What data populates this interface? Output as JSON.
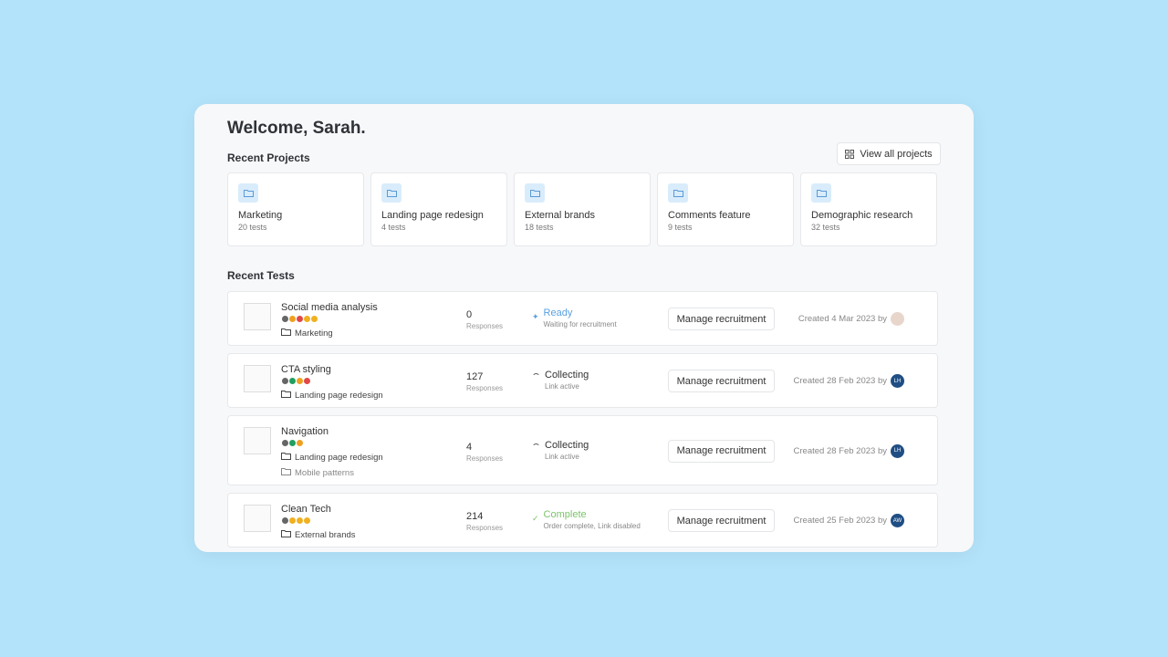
{
  "welcome": "Welcome, Sarah.",
  "recent_projects": {
    "title": "Recent Projects",
    "view_all": "View all projects",
    "items": [
      {
        "name": "Marketing",
        "count": "20 tests"
      },
      {
        "name": "Landing page redesign",
        "count": "4 tests"
      },
      {
        "name": "External brands",
        "count": "18 tests"
      },
      {
        "name": "Comments feature",
        "count": "9 tests"
      },
      {
        "name": "Demographic research",
        "count": "32 tests"
      }
    ]
  },
  "recent_tests": {
    "title": "Recent Tests",
    "responses_label": "Responses",
    "button": "Manage recruitment",
    "items": [
      {
        "name": "Social media analysis",
        "badges": [
          "#666666",
          "#f0a020",
          "#e04848",
          "#f0b020",
          "#f0b020"
        ],
        "project": "Marketing",
        "responses": "0",
        "status": "Ready",
        "status_color": "#5aa0e0",
        "status_icon": "sparkle-icon",
        "substatus": "Waiting for recruitment",
        "created": "Created 4 Mar 2023 by",
        "avatar": ""
      },
      {
        "name": "CTA styling",
        "badges": [
          "#666666",
          "#20a060",
          "#f0a020",
          "#e04848"
        ],
        "project": "Landing page redesign",
        "responses": "127",
        "status": "Collecting",
        "status_color": "#333333",
        "status_icon": "spinner-icon",
        "substatus": "Link active",
        "created": "Created 28 Feb 2023 by",
        "avatar": "LH"
      },
      {
        "name": "Navigation",
        "badges": [
          "#666666",
          "#20a060",
          "#f0a020"
        ],
        "project": "Landing page redesign",
        "extra": "Mobile patterns",
        "responses": "4",
        "status": "Collecting",
        "status_color": "#333333",
        "status_icon": "spinner-icon",
        "substatus": "Link active",
        "created": "Created 28 Feb 2023 by",
        "avatar": "LH"
      },
      {
        "name": "Clean Tech",
        "badges": [
          "#666666",
          "#f0b020",
          "#f0b020",
          "#f0b020"
        ],
        "project": "External brands",
        "responses": "214",
        "status": "Complete",
        "status_color": "#7cc36a",
        "status_icon": "check-icon",
        "substatus": "Order complete, Link disabled",
        "created": "Created 25 Feb 2023 by",
        "avatar": "AW"
      }
    ]
  }
}
